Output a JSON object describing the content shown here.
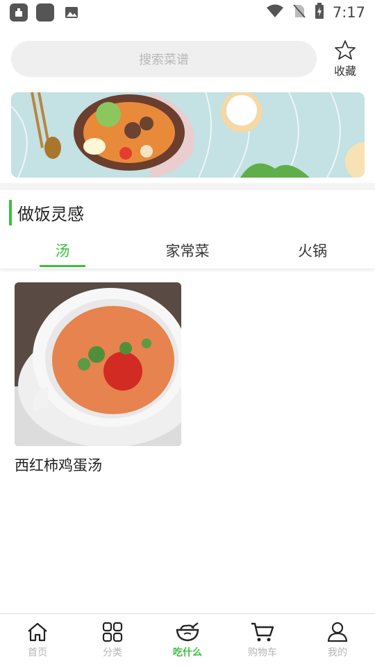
{
  "status_bar": {
    "time": "7:17"
  },
  "header": {
    "search_placeholder": "搜索菜谱",
    "favorite_label": "收藏"
  },
  "section": {
    "title": "做饭灵感"
  },
  "tabs": [
    {
      "label": "汤",
      "active": true
    },
    {
      "label": "家常菜",
      "active": false
    },
    {
      "label": "火锅",
      "active": false
    }
  ],
  "recipes": [
    {
      "title": "西红柿鸡蛋汤"
    }
  ],
  "bottom_nav": [
    {
      "label": "首页",
      "icon": "home-icon",
      "active": false
    },
    {
      "label": "分类",
      "icon": "grid-icon",
      "active": false
    },
    {
      "label": "吃什么",
      "icon": "bowl-icon",
      "active": true
    },
    {
      "label": "购物车",
      "icon": "cart-icon",
      "active": false
    },
    {
      "label": "我的",
      "icon": "user-icon",
      "active": false
    }
  ],
  "colors": {
    "accent": "#3cbf3f",
    "search_bg": "#efefef",
    "inactive": "#b5b5b5"
  }
}
